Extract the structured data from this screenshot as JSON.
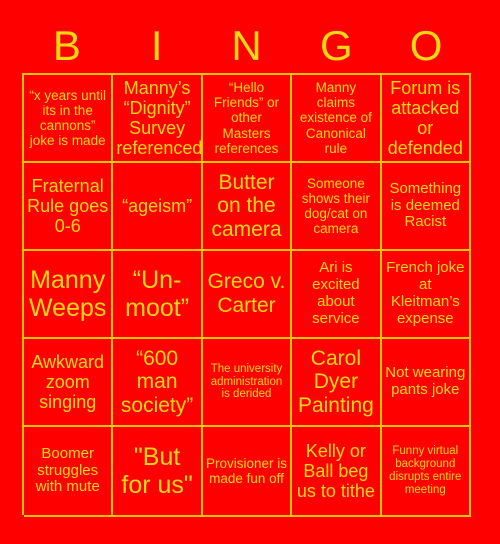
{
  "card": {
    "title_letters": [
      "B",
      "I",
      "N",
      "G",
      "O"
    ],
    "colors": {
      "background": "#FF0000",
      "text": "#FFD814",
      "grid_line": "#FFC400"
    },
    "rows": [
      [
        {
          "text": "“x years until its in the cannons” joke is made",
          "size": "s-sm"
        },
        {
          "text": "Manny’s “Dignity” Survey referenced",
          "size": "s-lg"
        },
        {
          "text": "“Hello Friends” or other Masters references",
          "size": "s-sm"
        },
        {
          "text": "Manny claims existence of Canonical rule",
          "size": "s-sm"
        },
        {
          "text": "Forum is attacked or defended",
          "size": "s-lg"
        }
      ],
      [
        {
          "text": "Fraternal Rule goes 0-6",
          "size": "s-lg"
        },
        {
          "text": "“ageism”",
          "size": "s-lg"
        },
        {
          "text": "Butter on the camera",
          "size": "s-xl"
        },
        {
          "text": "Someone shows their dog/cat on camera",
          "size": "s-sm"
        },
        {
          "text": "Something is deemed Racist",
          "size": "s-md"
        }
      ],
      [
        {
          "text": "Manny Weeps",
          "size": "s-xxl"
        },
        {
          "text": "“Un-moot”",
          "size": "s-xxl"
        },
        {
          "text": "Greco v. Carter",
          "size": "s-xl"
        },
        {
          "text": "Ari is excited about service",
          "size": "s-md"
        },
        {
          "text": "French joke at Kleitman’s expense",
          "size": "s-md"
        }
      ],
      [
        {
          "text": "Awkward zoom singing",
          "size": "s-lg"
        },
        {
          "text": "“600 man society”",
          "size": "s-xl"
        },
        {
          "text": "The university administration is derided",
          "size": "s-xs"
        },
        {
          "text": "Carol Dyer Painting",
          "size": "s-xl"
        },
        {
          "text": "Not wearing pants joke",
          "size": "s-md"
        }
      ],
      [
        {
          "text": "Boomer struggles with mute",
          "size": "s-md"
        },
        {
          "text": "\"But for us\"",
          "size": "s-xxl"
        },
        {
          "text": "Provisioner is made fun off",
          "size": "s-sm"
        },
        {
          "text": "Kelly or Ball beg us to tithe",
          "size": "s-lg"
        },
        {
          "text": "Funny virtual background disrupts entire meeting",
          "size": "s-xs"
        }
      ]
    ]
  }
}
